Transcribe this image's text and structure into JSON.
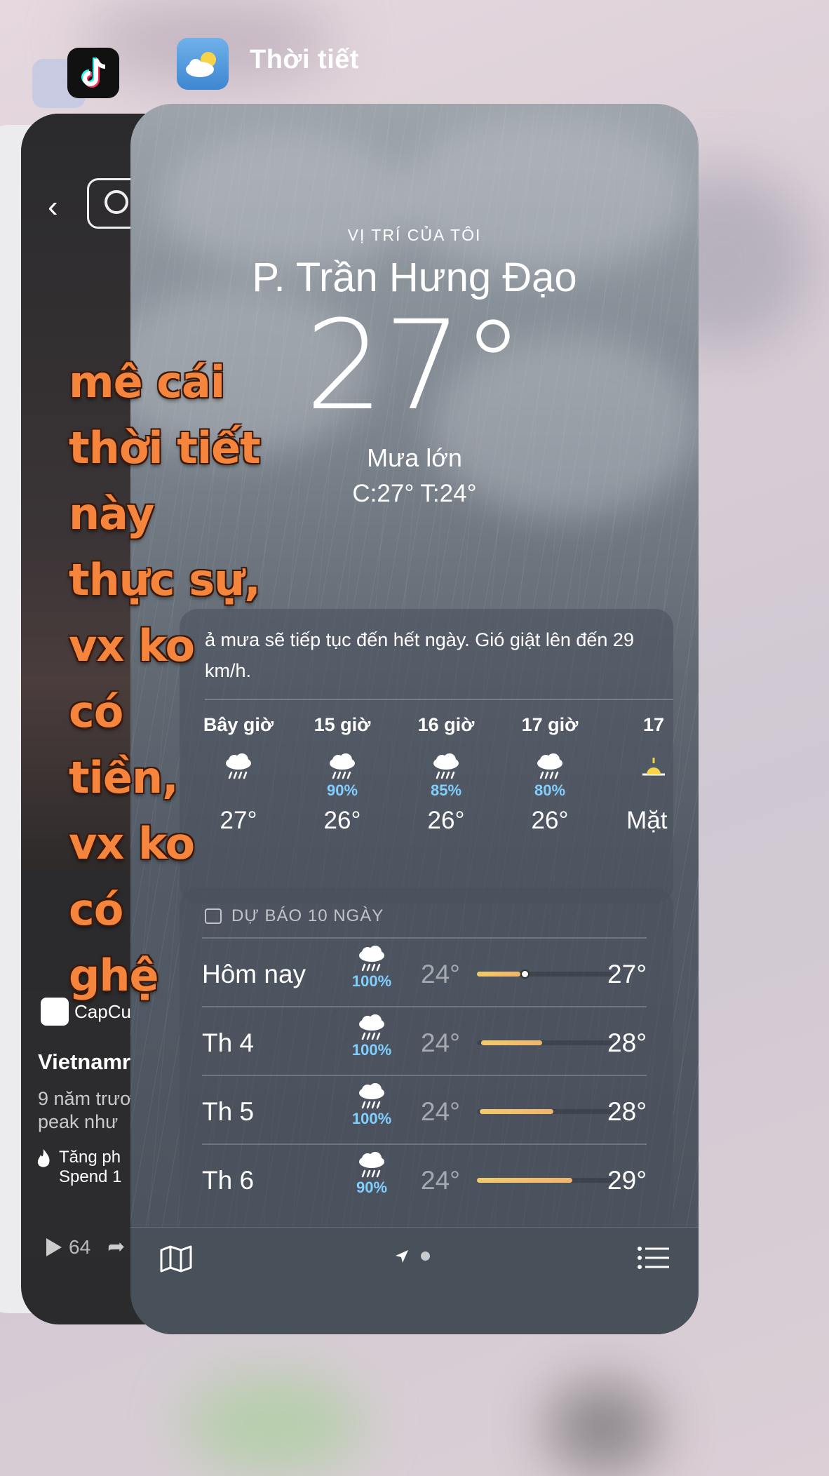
{
  "switcher": {
    "active_app_title": "Thời tiết"
  },
  "back_card": {
    "capcut_label": "CapCu",
    "video_title": "Vietnamr",
    "video_desc": "9 năm trươ\npeak như",
    "boost_text": "Tăng ph\nSpend 1",
    "play_count": "64"
  },
  "weather": {
    "location_label": "VỊ TRÍ CỦA TÔI",
    "location_name": "P. Trần Hưng Đạo",
    "temperature": "27°",
    "condition": "Mưa lớn",
    "high_low": "C:27°  T:24°",
    "summary": "ả mưa sẽ tiếp tục đến hết ngày. Gió giật lên đến 29 km/h.",
    "hourly": [
      {
        "time": "Bây giờ",
        "pop": "",
        "temp": "27°",
        "icon": "cloud-rain-icon"
      },
      {
        "time": "15 giờ",
        "pop": "90%",
        "temp": "26°",
        "icon": "cloud-rain-icon"
      },
      {
        "time": "16 giờ",
        "pop": "85%",
        "temp": "26°",
        "icon": "cloud-rain-icon"
      },
      {
        "time": "17 giờ",
        "pop": "80%",
        "temp": "26°",
        "icon": "cloud-rain-icon"
      },
      {
        "time": "17",
        "pop": "",
        "temp": "Mặt t",
        "icon": "sunset-icon"
      }
    ],
    "daily_title": "DỰ BÁO 10 NGÀY",
    "daily": [
      {
        "day": "Hôm nay",
        "pop": "100%",
        "low": "24°",
        "high": "27°",
        "bar_start": 0.0,
        "bar_end": 0.32,
        "current": 0.32
      },
      {
        "day": "Th 4",
        "pop": "100%",
        "low": "24°",
        "high": "28°",
        "bar_start": 0.03,
        "bar_end": 0.48
      },
      {
        "day": "Th 5",
        "pop": "100%",
        "low": "24°",
        "high": "28°",
        "bar_start": 0.02,
        "bar_end": 0.56
      },
      {
        "day": "Th 6",
        "pop": "90%",
        "low": "24°",
        "high": "29°",
        "bar_start": 0.0,
        "bar_end": 0.7
      }
    ]
  },
  "caption": [
    "mê cái",
    "thời tiết",
    "này",
    "thực sự,",
    "vx ko",
    "có",
    "tiền,",
    "vx ko",
    "có",
    "ghệ"
  ],
  "colors": {
    "caption": "#f5843d",
    "precip": "#80cfff",
    "temp_bar": "#f2cb6a"
  }
}
